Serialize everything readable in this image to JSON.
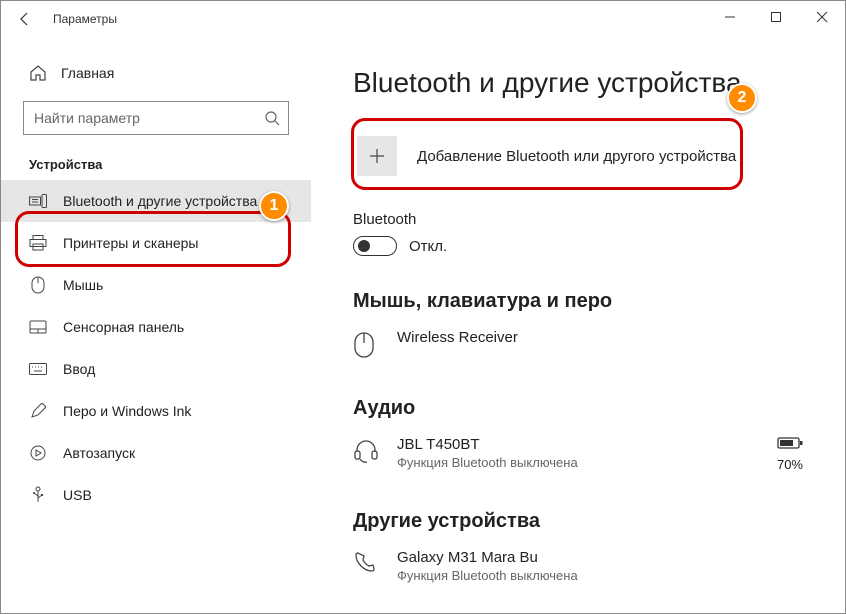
{
  "window": {
    "title": "Параметры"
  },
  "sidebar": {
    "home": "Главная",
    "search_placeholder": "Найти параметр",
    "category": "Устройства",
    "items": [
      {
        "label": "Bluetooth и другие устройства"
      },
      {
        "label": "Принтеры и сканеры"
      },
      {
        "label": "Мышь"
      },
      {
        "label": "Сенсорная панель"
      },
      {
        "label": "Ввод"
      },
      {
        "label": "Перо и Windows Ink"
      },
      {
        "label": "Автозапуск"
      },
      {
        "label": "USB"
      }
    ]
  },
  "main": {
    "title": "Bluetooth и другие устройства",
    "add_device": "Добавление Bluetooth или другого устройства",
    "bt_label": "Bluetooth",
    "bt_state": "Откл.",
    "sections": {
      "input": {
        "title": "Мышь, клавиатура и перо",
        "device1_name": "Wireless Receiver"
      },
      "audio": {
        "title": "Аудио",
        "device1_name": "JBL T450BT",
        "device1_sub": "Функция Bluetooth выключена",
        "device1_battery": "70%"
      },
      "other": {
        "title": "Другие устройства",
        "device1_name": "Galaxy M31 Mara Bu",
        "device1_sub": "Функция Bluetooth выключена"
      }
    }
  },
  "annotations": {
    "badge1": "1",
    "badge2": "2"
  }
}
